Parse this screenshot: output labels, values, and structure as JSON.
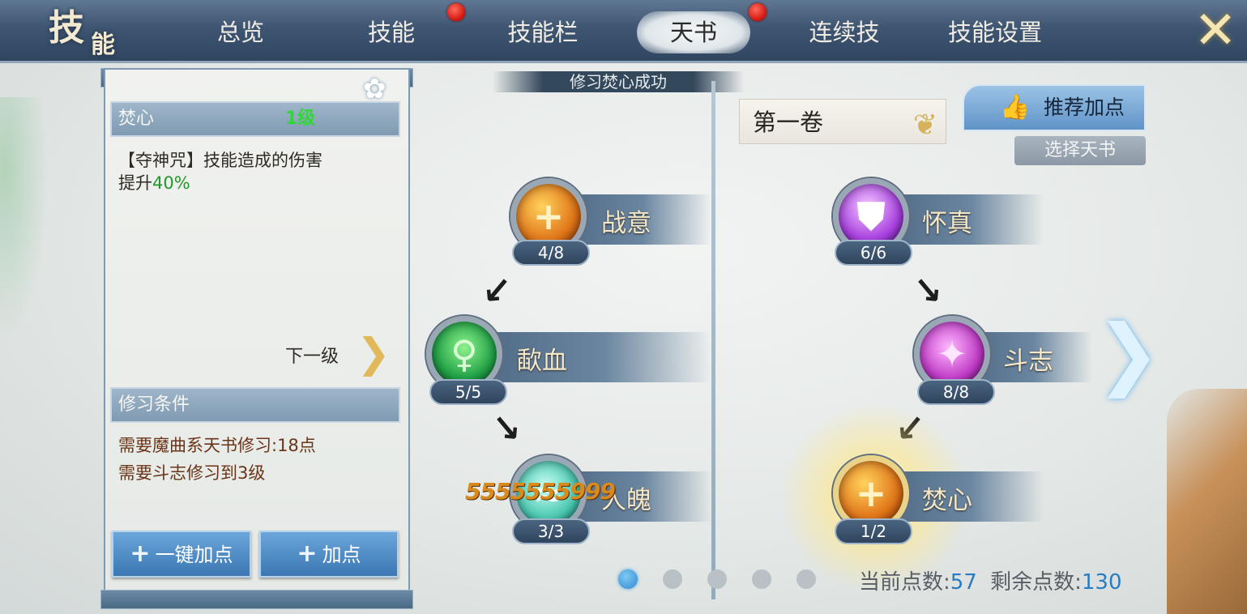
{
  "header": {
    "logo_char1": "技",
    "logo_char2": "能",
    "tabs": [
      {
        "label": "总览"
      },
      {
        "label": "技能"
      },
      {
        "label": "技能栏"
      },
      {
        "label": "天书"
      },
      {
        "label": "连续技"
      },
      {
        "label": "技能设置"
      }
    ],
    "active_tab": "天书",
    "close_icon": "close-x-icon"
  },
  "skill_detail": {
    "name": "焚心",
    "level": "1级",
    "desc_prefix": "【夺神咒】技能造成的伤害",
    "desc_line2": "提升",
    "desc_value": "40%",
    "next_level_label": "下一级",
    "requirements_title": "修习条件",
    "requirements": [
      "需要魔曲系天书修习:18点",
      "需要斗志修习到3级"
    ],
    "buttons": {
      "one_click": "一键加点",
      "add": "加点"
    }
  },
  "toast": "修习焚心成功",
  "damage_text": "5555555999",
  "tree_left": [
    {
      "name": "战意",
      "progress": "4/8"
    },
    {
      "name": "歃血",
      "progress": "5/5"
    },
    {
      "name": "人魄",
      "progress": "3/3"
    }
  ],
  "tree_right": [
    {
      "name": "怀真",
      "progress": "6/6"
    },
    {
      "name": "斗志",
      "progress": "8/8"
    },
    {
      "name": "焚心",
      "progress": "1/2"
    }
  ],
  "volume": {
    "label": "第一卷"
  },
  "recommend_button": "推荐加点",
  "select_book_button": "选择天书",
  "pagination": {
    "current": 1,
    "total": 5
  },
  "points": {
    "current_label": "当前点数:",
    "current_value": "57",
    "remaining_label": "剩余点数:",
    "remaining_value": "130"
  },
  "colors": {
    "accent_green": "#33d63a",
    "button_blue": "#3c77b4",
    "points_blue": "#2a7cc1"
  }
}
